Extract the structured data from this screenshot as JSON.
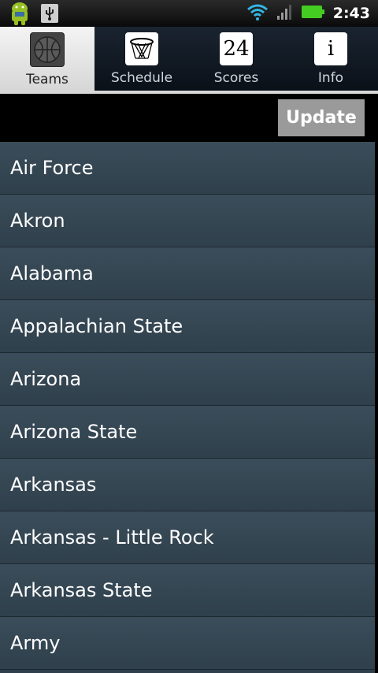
{
  "status_bar": {
    "time": "2:43",
    "icons": [
      "android-icon",
      "usb-icon",
      "wifi-icon",
      "signal-icon",
      "battery-icon"
    ],
    "battery_color": "#44cc22"
  },
  "tabs": [
    {
      "label": "Teams",
      "icon": "basketball-icon",
      "active": true
    },
    {
      "label": "Schedule",
      "icon": "hoop-icon",
      "active": false
    },
    {
      "label": "Scores",
      "icon_text": "24",
      "active": false
    },
    {
      "label": "Info",
      "icon_text": "i",
      "active": false
    }
  ],
  "toolbar": {
    "update_label": "Update"
  },
  "teams": [
    "Air Force",
    "Akron",
    "Alabama",
    "Appalachian State",
    "Arizona",
    "Arizona State",
    "Arkansas",
    "Arkansas - Little Rock",
    "Arkansas State",
    "Army"
  ]
}
